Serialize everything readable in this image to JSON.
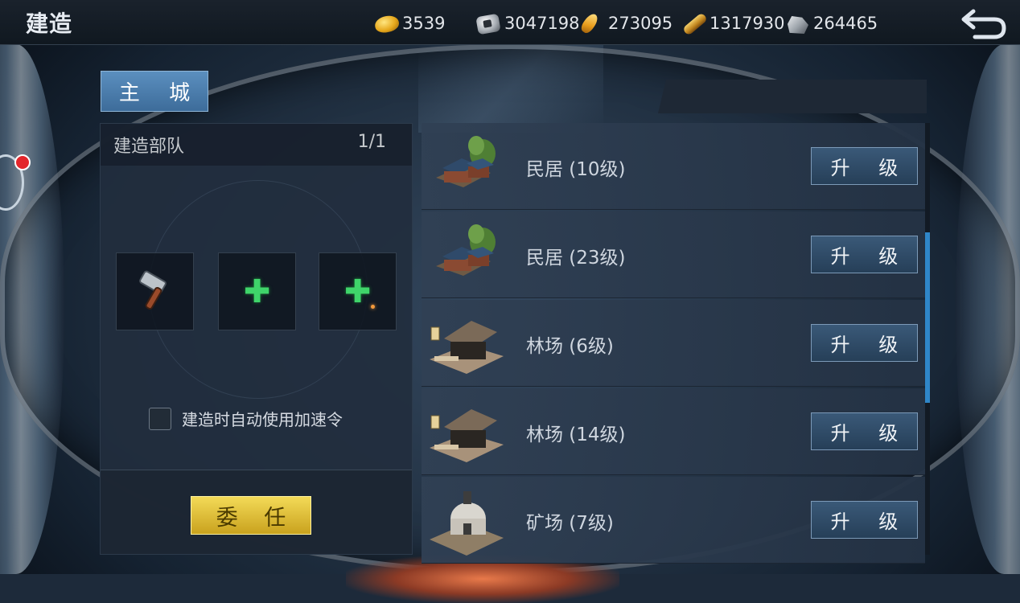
{
  "header": {
    "title": "建造",
    "resources": [
      {
        "icon": "gold-ingot-icon",
        "value": "3539"
      },
      {
        "icon": "silver-coin-icon",
        "value": "3047198"
      },
      {
        "icon": "grain-icon",
        "value": "273095"
      },
      {
        "icon": "wood-log-icon",
        "value": "1317930"
      },
      {
        "icon": "stone-icon",
        "value": "264465"
      }
    ],
    "back_icon": "back-arrow-icon"
  },
  "tabs": {
    "main_city": "主 城"
  },
  "builders": {
    "title": "建造部队",
    "count": "1/1",
    "slots": [
      {
        "icon": "hammer-icon"
      },
      {
        "icon": "plus-icon"
      },
      {
        "icon": "plus-icon"
      }
    ],
    "auto_speedup_label": "建造时自动使用加速令",
    "auto_speedup_checked": false,
    "appoint_label": "委 任"
  },
  "buildings": [
    {
      "name": "民居 (10级)",
      "type": "residence",
      "action": "升 级"
    },
    {
      "name": "民居 (23级)",
      "type": "residence",
      "action": "升 级"
    },
    {
      "name": "林场 (6级)",
      "type": "lumberyard",
      "action": "升 级"
    },
    {
      "name": "林场 (14级)",
      "type": "lumberyard",
      "action": "升 级"
    },
    {
      "name": "矿场 (7级)",
      "type": "mine",
      "action": "升 级"
    }
  ],
  "colors": {
    "accent_blue": "#3d6c9a",
    "gold_button": "#e0bd35",
    "plus_green": "#3fd46a",
    "scroll_blue": "#2f86c8",
    "notify_red": "#e3262b"
  }
}
